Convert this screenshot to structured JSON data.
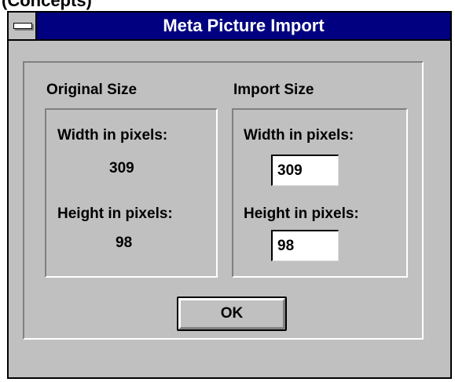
{
  "top_strip": {
    "partial_text": "(Concepts)"
  },
  "window": {
    "title": "Meta Picture Import",
    "sysmenu_icon": "system-menu-icon"
  },
  "original_size": {
    "heading": "Original Size",
    "width_label": "Width in pixels:",
    "width_value": "309",
    "height_label": "Height in pixels:",
    "height_value": "98"
  },
  "import_size": {
    "heading": "Import Size",
    "width_label": "Width in pixels:",
    "width_value": "309",
    "height_label": "Height in pixels:",
    "height_value": "98"
  },
  "buttons": {
    "ok_label": "OK"
  },
  "colors": {
    "titlebar": "#000080",
    "dialog_face": "#c0c0c0",
    "shadow": "#808080",
    "highlight": "#ffffff"
  }
}
